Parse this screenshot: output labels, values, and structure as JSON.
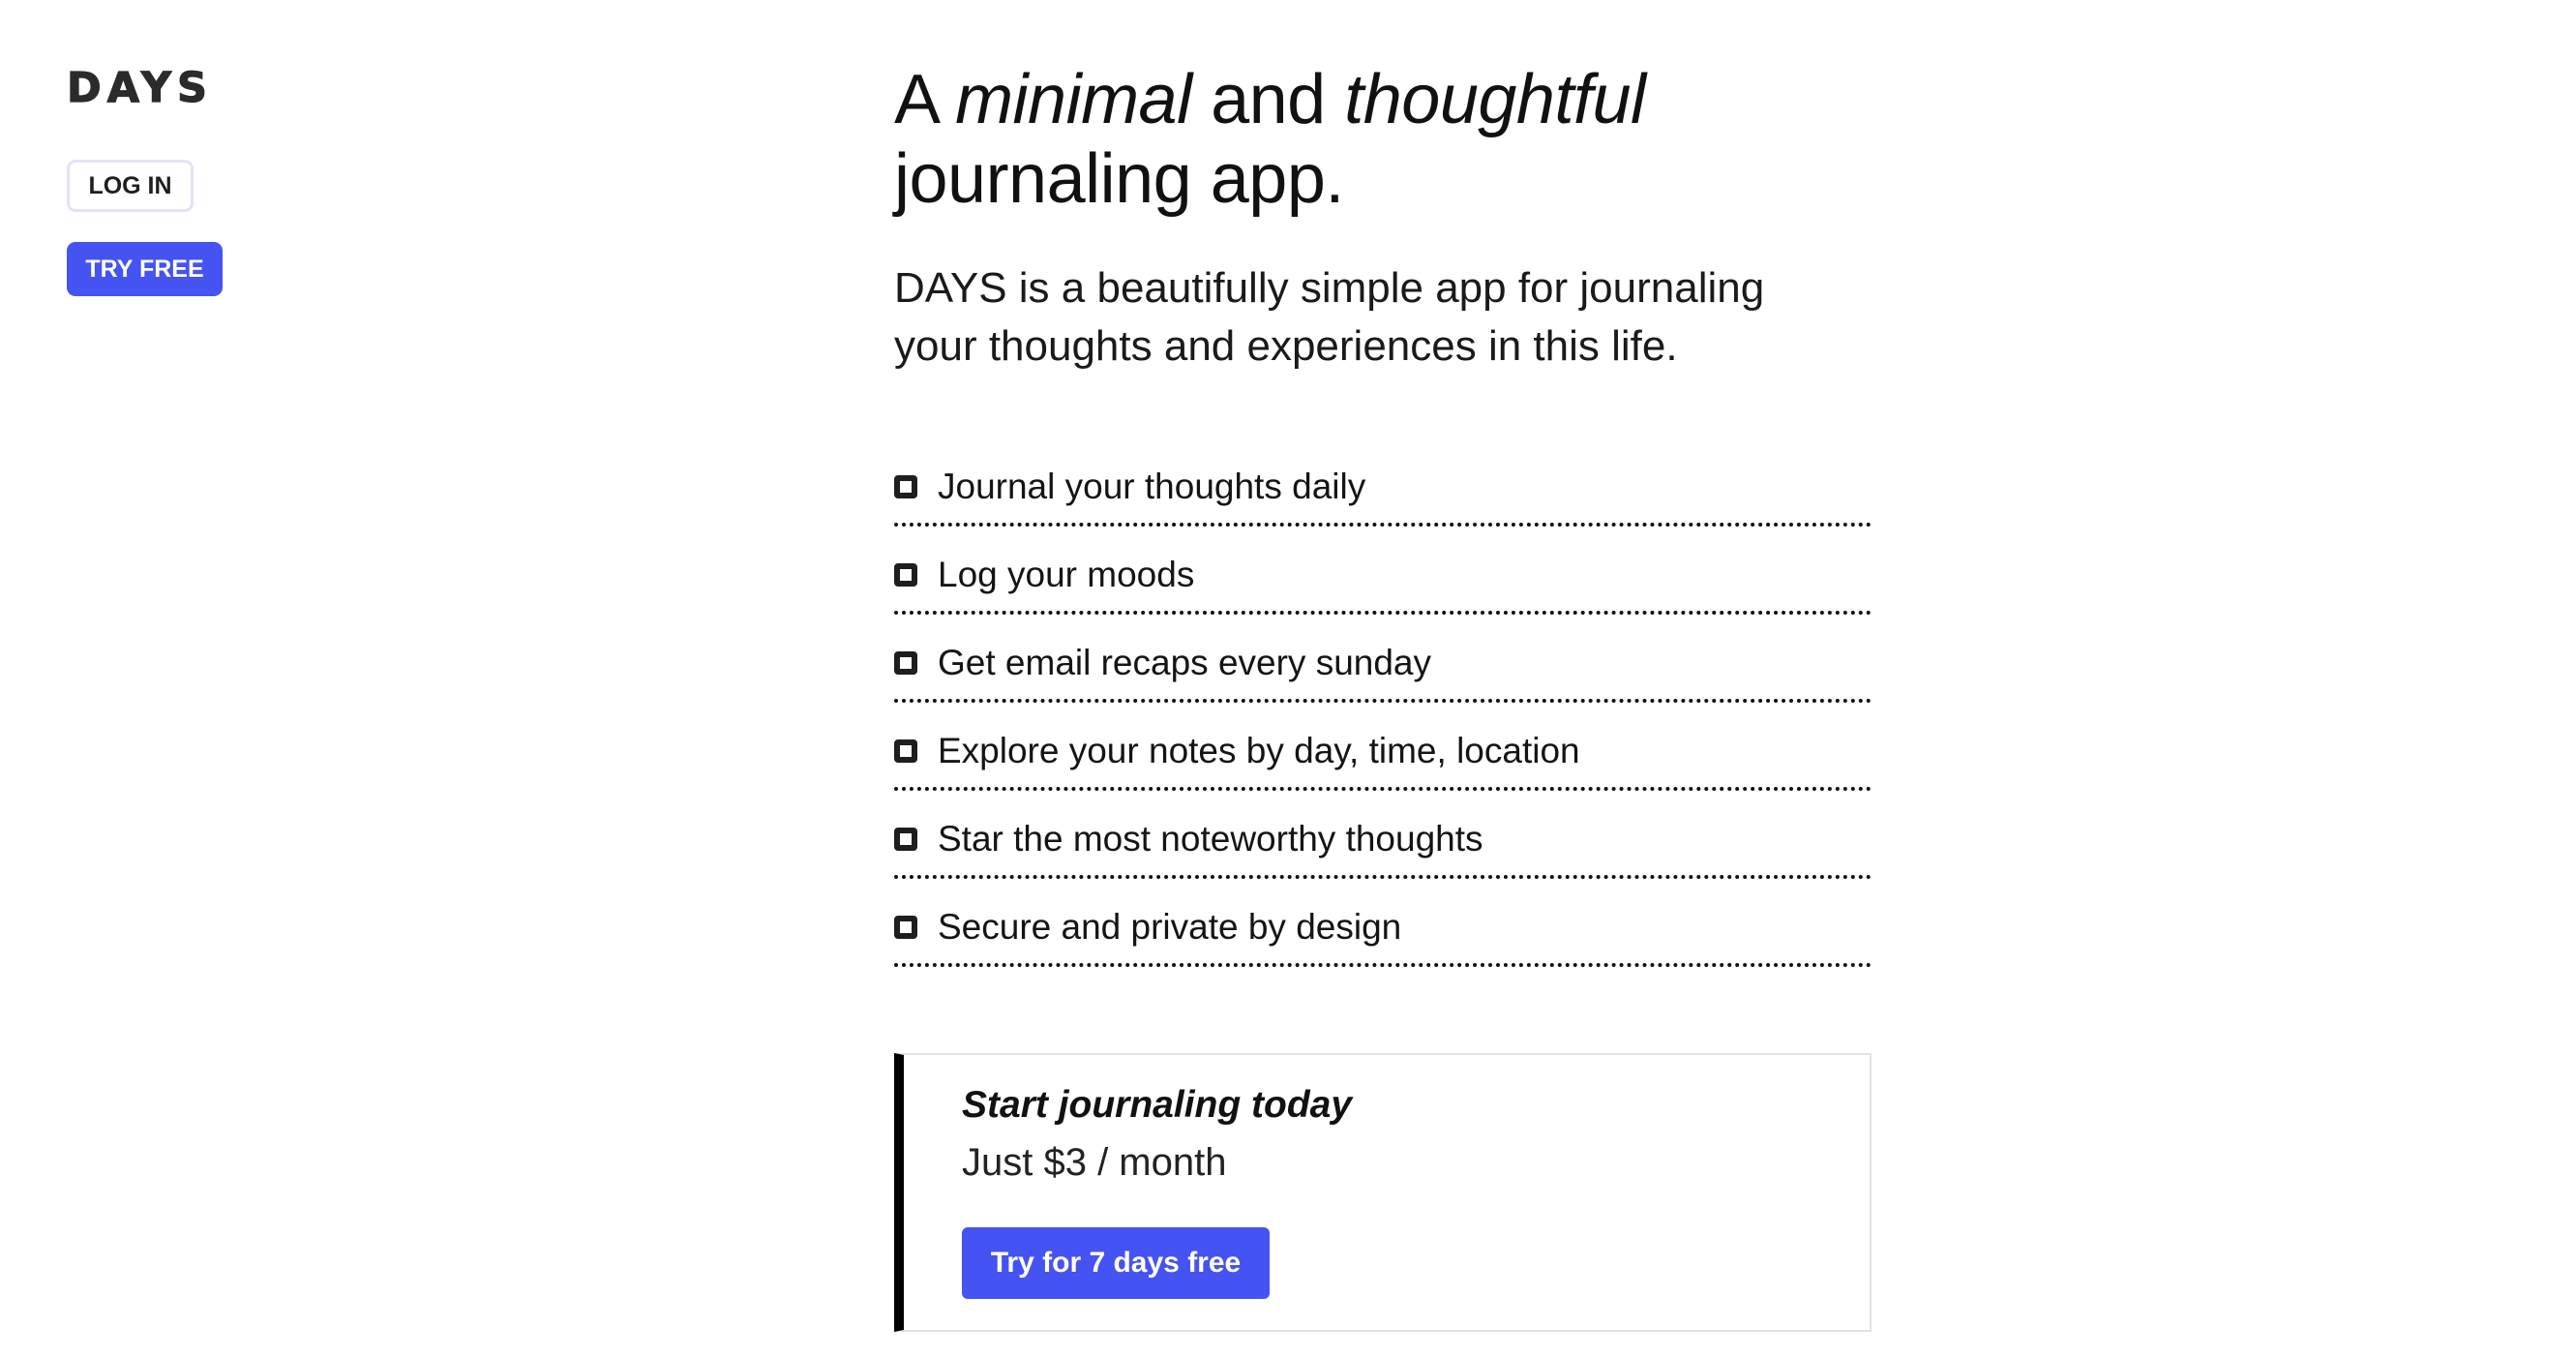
{
  "brand": {
    "logo_text": "DAYS"
  },
  "sidebar": {
    "login_label": "LOG IN",
    "try_free_label": "TRY FREE"
  },
  "hero": {
    "headline_part1": "A ",
    "headline_em1": "minimal",
    "headline_part2": " and ",
    "headline_em2": "thoughtful",
    "headline_part3": "journaling app.",
    "intro_line1": "DAYS is a beautifully simple app for journaling",
    "intro_line2": "your thoughts and experiences in this life."
  },
  "features": [
    {
      "label": "Journal your thoughts daily"
    },
    {
      "label": "Log your moods"
    },
    {
      "label": "Get email recaps every sunday"
    },
    {
      "label": "Explore your notes by day, time, location"
    },
    {
      "label": "Star the most noteworthy thoughts"
    },
    {
      "label": "Secure and private by design"
    }
  ],
  "cta": {
    "title": "Start journaling today",
    "price": "Just $3 / month",
    "button_label": "Try for 7 days free"
  },
  "colors": {
    "accent": "#4453f2",
    "text": "#111111",
    "cta_border_left": "#000000"
  }
}
